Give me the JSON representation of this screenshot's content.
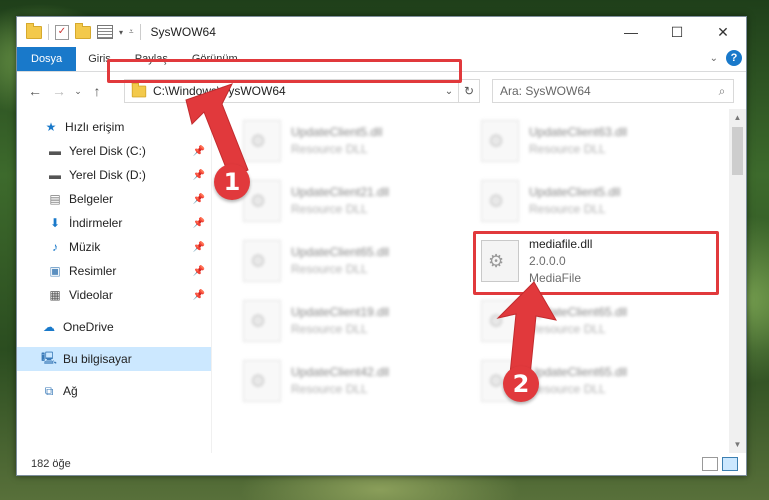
{
  "window": {
    "title": "SysWOW64"
  },
  "ribbon": {
    "tabs": [
      "Dosya",
      "Giriş",
      "Paylaş",
      "Görünüm"
    ]
  },
  "address": {
    "path": "C:\\Windows\\SysWOW64"
  },
  "search": {
    "placeholder": "Ara: SysWOW64"
  },
  "sidebar": {
    "items": [
      {
        "label": "Hızlı erişim",
        "icon": "star-icon"
      },
      {
        "label": "Yerel Disk (C:)",
        "icon": "drive-icon"
      },
      {
        "label": "Yerel Disk (D:)",
        "icon": "drive-icon"
      },
      {
        "label": "Belgeler",
        "icon": "documents-icon"
      },
      {
        "label": "İndirmeler",
        "icon": "download-icon"
      },
      {
        "label": "Müzik",
        "icon": "music-icon"
      },
      {
        "label": "Resimler",
        "icon": "pictures-icon"
      },
      {
        "label": "Videolar",
        "icon": "videos-icon"
      },
      {
        "label": "OneDrive",
        "icon": "cloud-icon"
      },
      {
        "label": "Bu bilgisayar",
        "icon": "computer-icon"
      },
      {
        "label": "Ağ",
        "icon": "network-icon"
      }
    ]
  },
  "files": [
    {
      "name": "UpdateClient5.dll",
      "sub": "Resource DLL"
    },
    {
      "name": "UpdateClient63.dll",
      "sub": "Resource DLL"
    },
    {
      "name": "UpdateClient21.dll",
      "sub": "Resource DLL"
    },
    {
      "name": "UpdateClient5.dll",
      "sub": "Resource DLL"
    },
    {
      "name": "UpdateClient65.dll",
      "sub": "Resource DLL"
    },
    {
      "name": "mediafile.dll",
      "version": "2.0.0.0",
      "sub": "MediaFile"
    },
    {
      "name": "UpdateClient19.dll",
      "sub": "Resource DLL"
    },
    {
      "name": "UpdateClient65.dll",
      "sub": "Resource DLL"
    },
    {
      "name": "UpdateClient42.dll",
      "sub": "Resource DLL"
    },
    {
      "name": "UpdateClient65.dll",
      "sub": "Resource DLL"
    }
  ],
  "status": {
    "count": "182 öğe"
  },
  "annotations": {
    "step1": "1",
    "step2": "2"
  },
  "colors": {
    "accent": "#1979ca",
    "highlight": "#e1393c",
    "selected": "#cce8ff"
  }
}
